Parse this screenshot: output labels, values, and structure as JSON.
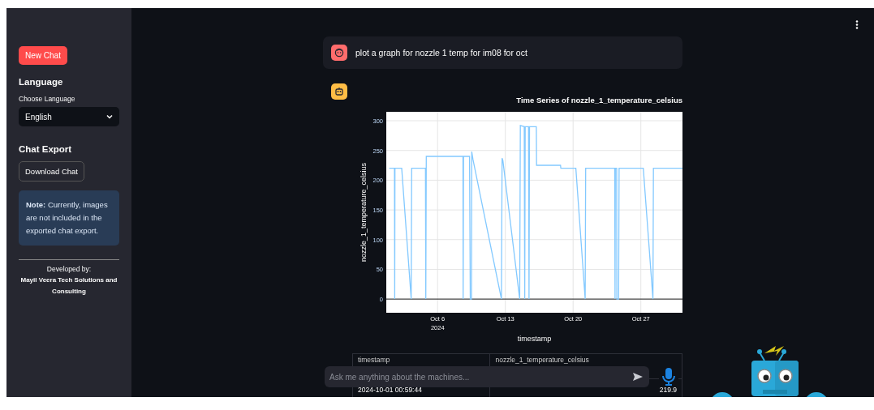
{
  "sidebar": {
    "new_chat_button": "New Chat",
    "language_heading": "Language",
    "language_select": {
      "label": "Choose Language",
      "value": "English"
    },
    "export_heading": "Chat Export",
    "download_button": "Download Chat",
    "note": "**Note:** Currently, images are not included in the exported chat export.",
    "credit": {
      "line_1": "Developed by:",
      "line_2": "Mayil Veera Tech Solutions and Consulting"
    }
  },
  "messages": [
    {
      "kind": "user",
      "text": "plot a graph for nozzle 1 temp for im08 for oct"
    },
    {
      "kind": "assistant",
      "chart_data": {
        "type": "line",
        "title": "Time Series of nozzle_1_temperature_celsius",
        "xlabel": "timestamp",
        "ylabel": "nozzle_1_temperature_celsius",
        "x": [
          "2024-10-01T00:00",
          "2024-10-01T13:12",
          "2024-10-01T13:41",
          "2024-10-01T14:24",
          "2024-10-02T06:58",
          "2024-10-03T06:29",
          "2024-10-03T07:41",
          "2024-10-04T18:00",
          "2024-10-04T18:43",
          "2024-10-04T19:55",
          "2024-10-08T14:53",
          "2024-10-08T15:22",
          "2024-10-08T16:19",
          "2024-10-09T07:12",
          "2024-10-09T09:07",
          "2024-10-09T12:00",
          "2024-10-09T12:43",
          "2024-10-09T15:36",
          "2024-10-12T14:24",
          "2024-10-12T15:50",
          "2024-10-12T18:00",
          "2024-10-14T11:31",
          "2024-10-14T13:12",
          "2024-10-14T22:48",
          "2024-10-15T00:00",
          "2024-10-15T01:12",
          "2024-10-15T09:36",
          "2024-10-15T10:48",
          "2024-10-15T12:00",
          "2024-10-16T04:48",
          "2024-10-16T05:31",
          "2024-10-18T16:48",
          "2024-10-18T17:31",
          "2024-10-20T06:43",
          "2024-10-21T06:00",
          "2024-10-21T07:12",
          "2024-10-24T07:12",
          "2024-10-24T07:55",
          "2024-10-24T08:53",
          "2024-10-24T12:00",
          "2024-10-24T12:29",
          "2024-10-24T16:48",
          "2024-10-24T18:00",
          "2024-10-27T06:00",
          "2024-10-28T06:00",
          "2024-10-28T07:12",
          "2024-10-31T07:12"
        ],
        "series": [
          {
            "color": "#83c9ff",
            "values": [
              220,
              220,
              0,
              220,
              220,
              0,
              220,
              220,
              0,
              240,
              240,
              0,
              240,
              240,
              0,
              0,
              248,
              235,
              0,
              237,
              233,
              0,
              292,
              290,
              0,
              290,
              290,
              0,
              290,
              290,
              225,
              225,
              220,
              220,
              0,
              220,
              220,
              0,
              220,
              220,
              0,
              0,
              220,
              220,
              0,
              220,
              220
            ]
          }
        ],
        "xlim": [
          "2024-09-30T16:48",
          "2024-10-31T07:12"
        ],
        "ylim": [
          -23,
          315
        ],
        "xticks": [
          {
            "value": "2024-10-06T00:00",
            "label": "Oct 6"
          },
          {
            "value": "2024-10-13T00:00",
            "label": "Oct 13"
          },
          {
            "value": "2024-10-20T00:00",
            "label": "Oct 20"
          },
          {
            "value": "2024-10-27T00:00",
            "label": "Oct 27"
          }
        ],
        "yticks": [
          0,
          50,
          100,
          150,
          200,
          250,
          300
        ],
        "grid": true
      },
      "xtick_year": "2024",
      "table": {
        "columns": [
          "timestamp",
          "nozzle_1_temperature_celsius"
        ],
        "rows": [
          [
            "2024-10-01 00:59:44",
            "219.9"
          ]
        ]
      }
    }
  ],
  "chat_input": {
    "placeholder": "Ask me anything about the machines..."
  }
}
